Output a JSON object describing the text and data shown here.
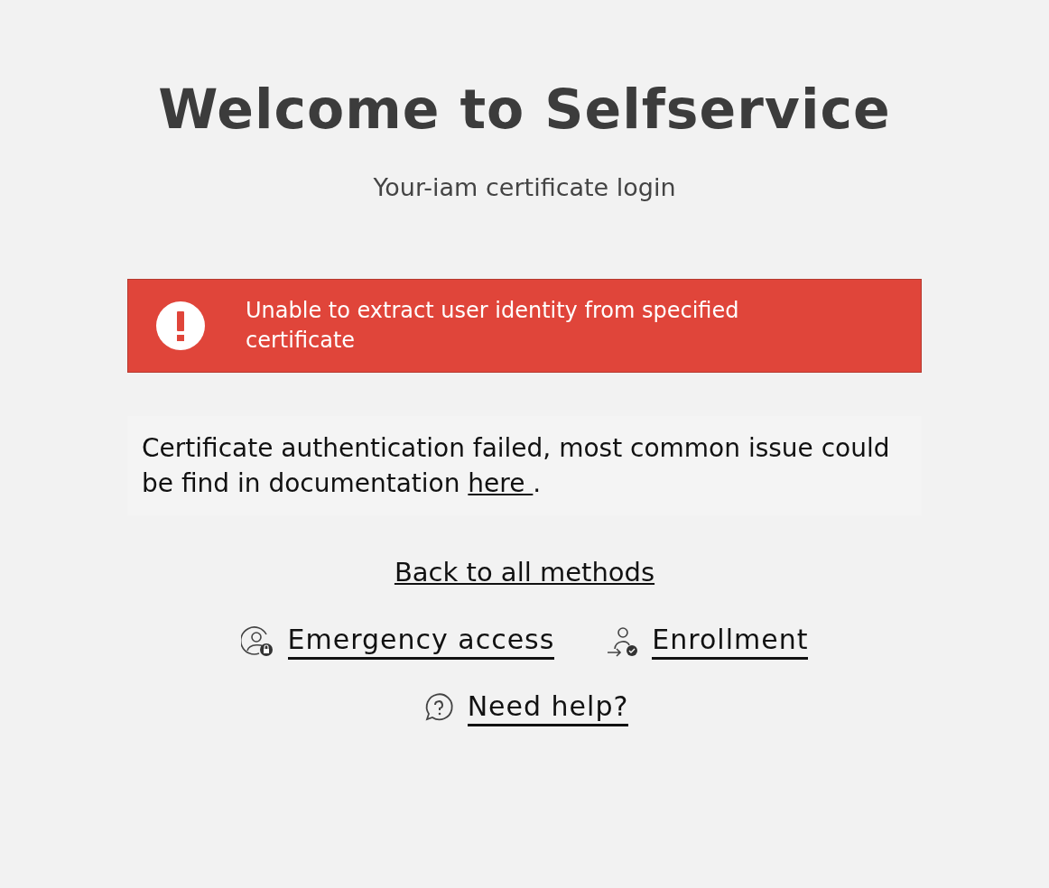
{
  "title": "Welcome to Selfservice",
  "subtitle": "Your-iam certificate login",
  "alert": {
    "kind": "error",
    "message": "Unable to extract user identity from specified certificate"
  },
  "info": {
    "text": "Certificate authentication failed, most common issue could be find in documentation",
    "link": "here ",
    "after": "."
  },
  "back_link": "Back to all methods",
  "links": [
    {
      "kind": "emergency",
      "label": "Emergency access"
    },
    {
      "kind": "enrollment",
      "label": "Enrollment"
    },
    {
      "kind": "help",
      "label": "Need help?"
    }
  ]
}
